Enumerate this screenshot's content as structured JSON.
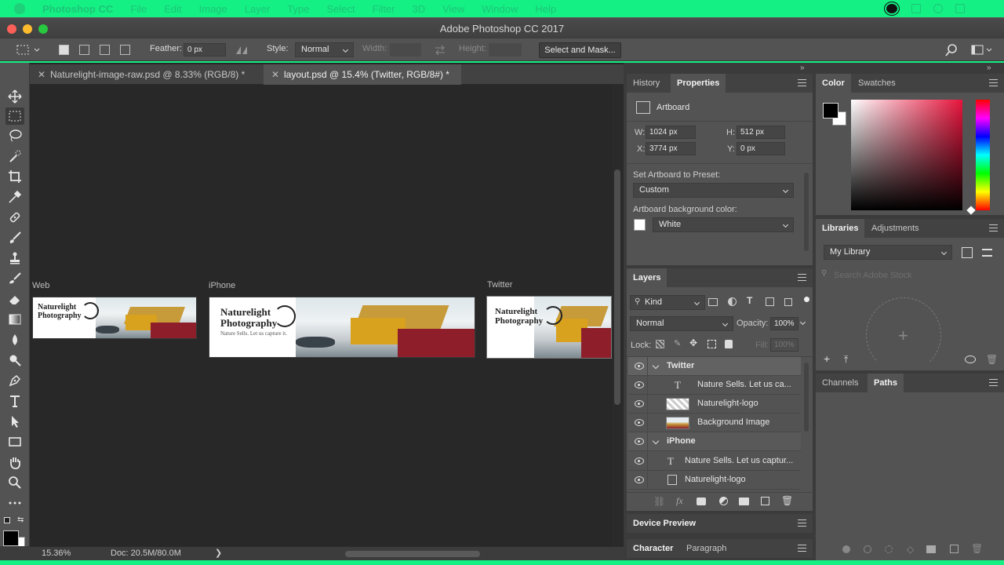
{
  "menubar": {
    "app": "Photoshop CC",
    "items": [
      "File",
      "Edit",
      "Image",
      "Layer",
      "Type",
      "Select",
      "Filter",
      "3D",
      "View",
      "Window",
      "Help"
    ]
  },
  "window": {
    "title": "Adobe Photoshop CC 2017"
  },
  "options": {
    "feather_label": "Feather:",
    "feather_value": "0 px",
    "style_label": "Style:",
    "style_value": "Normal",
    "width_label": "Width:",
    "height_label": "Height:",
    "select_mask": "Select and Mask..."
  },
  "tabs": [
    {
      "label": "Naturelight-image-raw.psd @ 8.33% (RGB/8) *"
    },
    {
      "label": "layout.psd @ 15.4% (Twitter, RGB/8#) *"
    }
  ],
  "artboards": [
    {
      "label": "Web",
      "logo": "Naturelight Photography"
    },
    {
      "label": "iPhone",
      "logo": "Naturelight Photography",
      "tagline": "Nature Sells. Let us capture it."
    },
    {
      "label": "Twitter",
      "logo": "Naturelight Photography"
    }
  ],
  "status": {
    "zoom": "15.36%",
    "doc": "Doc: 20.5M/80.0M",
    "arrow": "❯"
  },
  "properties_panel": {
    "tabs": [
      "History",
      "Properties"
    ],
    "artboard_title": "Artboard",
    "w_label": "W:",
    "w_value": "1024 px",
    "h_label": "H:",
    "h_value": "512 px",
    "x_label": "X:",
    "x_value": "3774 px",
    "y_label": "Y:",
    "y_value": "0 px",
    "preset_label": "Set Artboard to Preset:",
    "preset_value": "Custom",
    "bg_label": "Artboard background color:",
    "bg_value": "White"
  },
  "color_panel": {
    "tabs": [
      "Color",
      "Swatches"
    ]
  },
  "libraries_panel": {
    "tabs": [
      "Libraries",
      "Adjustments"
    ],
    "library": "My Library",
    "search_placeholder": "Search Adobe Stock"
  },
  "layers_panel": {
    "title": "Layers",
    "kind": "Kind",
    "blend": "Normal",
    "opacity_label": "Opacity:",
    "opacity_value": "100%",
    "lock_label": "Lock:",
    "fill_label": "Fill:",
    "fill_value": "100%",
    "layers": [
      {
        "name": "Twitter",
        "type": "group"
      },
      {
        "name": "Nature Sells. Let us ca...",
        "type": "text"
      },
      {
        "name": "Naturelight-logo",
        "type": "image"
      },
      {
        "name": "Background Image",
        "type": "image"
      },
      {
        "name": "iPhone",
        "type": "group"
      },
      {
        "name": "Nature Sells. Let us captur...",
        "type": "text"
      },
      {
        "name": "Naturelight-logo",
        "type": "smart"
      }
    ]
  },
  "channels_panel": {
    "tabs": [
      "Channels",
      "Paths"
    ]
  },
  "device_preview": {
    "title": "Device Preview"
  },
  "character_panel": {
    "tabs": [
      "Character",
      "Paragraph"
    ]
  },
  "colors": {
    "accent": "#14f084",
    "panel": "#535353",
    "canvas": "#282828"
  }
}
